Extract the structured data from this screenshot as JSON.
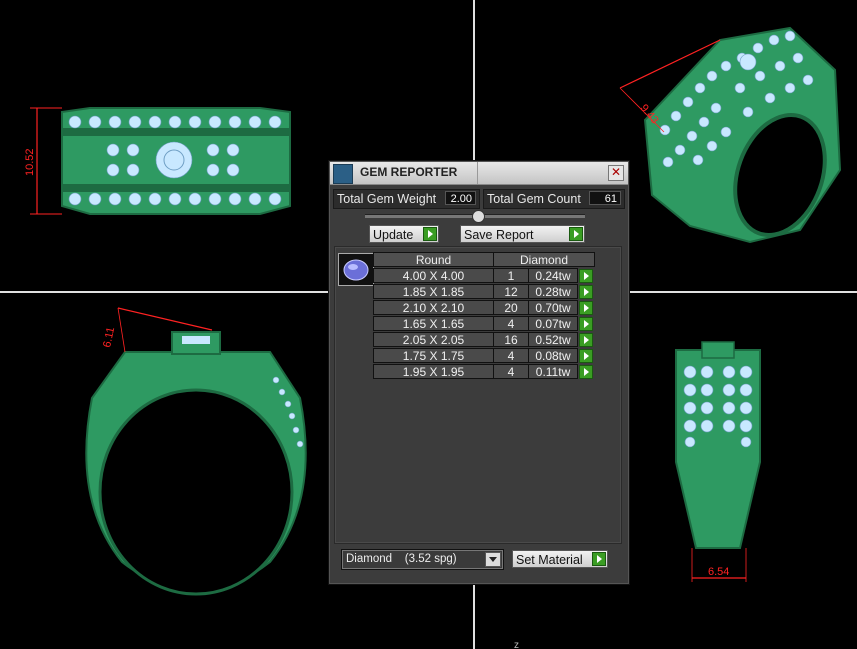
{
  "window": {
    "title": "GEM REPORTER",
    "close_glyph": "✕"
  },
  "stats": {
    "weight_label": "Total Gem Weight",
    "weight_value": "2.00",
    "count_label": "Total Gem Count",
    "count_value": "61"
  },
  "buttons": {
    "update_label": "Update",
    "save_report_label": "Save Report",
    "set_material_label": "Set Material"
  },
  "table": {
    "shape_header": "Round",
    "material_header": "Diamond",
    "rows": [
      {
        "size": "4.00 X 4.00",
        "count": "1",
        "weight": "0.24tw"
      },
      {
        "size": "1.85 X 1.85",
        "count": "12",
        "weight": "0.28tw"
      },
      {
        "size": "2.10 X 2.10",
        "count": "20",
        "weight": "0.70tw"
      },
      {
        "size": "1.65 X 1.65",
        "count": "4",
        "weight": "0.07tw"
      },
      {
        "size": "2.05 X 2.05",
        "count": "16",
        "weight": "0.52tw"
      },
      {
        "size": "1.75 X 1.75",
        "count": "4",
        "weight": "0.08tw"
      },
      {
        "size": "1.95 X 1.95",
        "count": "4",
        "weight": "0.11tw"
      }
    ]
  },
  "material_select": {
    "selected": "Diamond    (3.52 spg)"
  },
  "viewport": {
    "dim_top_left": "10.52",
    "dim_bottom_left": "6.11",
    "dim_top_right": "9.43",
    "dim_bottom_right": "6.54",
    "bottom_marker": "z",
    "ring_color": "#2e9a62",
    "gem_color": "#c8e8ff",
    "dimension_color": "#ff2222"
  }
}
